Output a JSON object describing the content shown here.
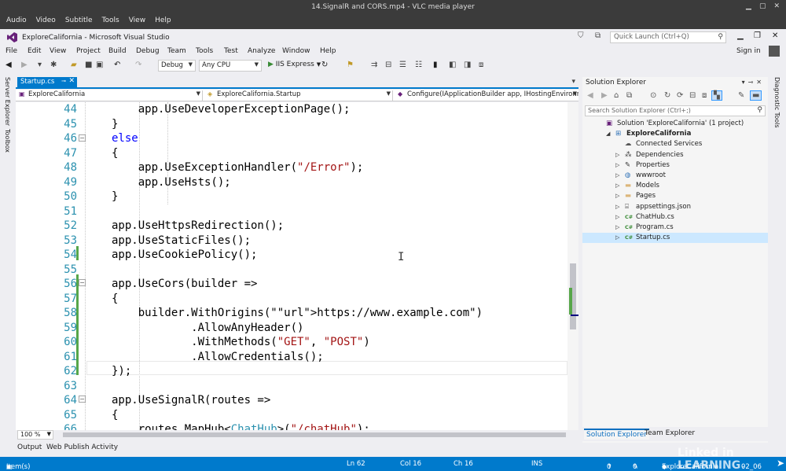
{
  "vlc": {
    "title": "14.SignalR and CORS.mp4 - VLC media player",
    "menu": [
      "Audio",
      "Video",
      "Subtitle",
      "Tools",
      "View",
      "Help"
    ]
  },
  "vs": {
    "title": "ExploreCalifornia - Microsoft Visual Studio",
    "quick_launch_placeholder": "Quick Launch (Ctrl+Q)",
    "menu": [
      "File",
      "Edit",
      "View",
      "Project",
      "Build",
      "Debug",
      "Team",
      "Tools",
      "Test",
      "Analyze",
      "Window",
      "Help"
    ],
    "sign_in": "Sign in"
  },
  "toolbar": {
    "config": "Debug",
    "platform": "Any CPU",
    "run_target": "IIS Express"
  },
  "side_left": {
    "server_explorer": "Server Explorer",
    "toolbox": "Toolbox"
  },
  "side_right": {
    "diagnostic_tools": "Diagnostic Tools"
  },
  "doc_tab": {
    "label": "Startup.cs"
  },
  "nav": {
    "project": "ExploreCalifornia",
    "class": "ExploreCalifornia.Startup",
    "member": "Configure(IApplicationBuilder app, IHostingEnvironme"
  },
  "editor": {
    "lines": [
      {
        "n": "44",
        "t": "            app.UseDeveloperExceptionPage();"
      },
      {
        "n": "45",
        "t": "        }"
      },
      {
        "n": "46",
        "t": "        else"
      },
      {
        "n": "47",
        "t": "        {"
      },
      {
        "n": "48",
        "t": "            app.UseExceptionHandler(\"/Error\");"
      },
      {
        "n": "49",
        "t": "            app.UseHsts();"
      },
      {
        "n": "50",
        "t": "        }"
      },
      {
        "n": "51",
        "t": ""
      },
      {
        "n": "52",
        "t": "        app.UseHttpsRedirection();"
      },
      {
        "n": "53",
        "t": "        app.UseStaticFiles();"
      },
      {
        "n": "54",
        "t": "        app.UseCookiePolicy();"
      },
      {
        "n": "55",
        "t": ""
      },
      {
        "n": "56",
        "t": "        app.UseCors(builder =>"
      },
      {
        "n": "57",
        "t": "        {"
      },
      {
        "n": "58",
        "t": "            builder.WithOrigins(\"https://www.example.com\")"
      },
      {
        "n": "59",
        "t": "                    .AllowAnyHeader()"
      },
      {
        "n": "60",
        "t": "                    .WithMethods(\"GET\", \"POST\")"
      },
      {
        "n": "61",
        "t": "                    .AllowCredentials();"
      },
      {
        "n": "62",
        "t": "        });"
      },
      {
        "n": "63",
        "t": ""
      },
      {
        "n": "64",
        "t": "        app.UseSignalR(routes =>"
      },
      {
        "n": "65",
        "t": "        {"
      },
      {
        "n": "66",
        "t": "            routes.MapHub<ChatHub>(\"/chatHub\");"
      }
    ]
  },
  "zoom": "100 %",
  "bottom_tabs": [
    "Output",
    "Web Publish Activity"
  ],
  "solution_explorer": {
    "title": "Solution Explorer",
    "search_placeholder": "Search Solution Explorer (Ctrl+;)",
    "tree": [
      {
        "label": "Solution 'ExploreCalifornia' (1 project)",
        "level": 0,
        "exp": "",
        "icon": "solution-icon"
      },
      {
        "label": "ExploreCalifornia",
        "level": 1,
        "exp": "open",
        "icon": "project-icon",
        "bold": true
      },
      {
        "label": "Connected Services",
        "level": 2,
        "exp": "",
        "icon": "connected-services-icon"
      },
      {
        "label": "Dependencies",
        "level": 2,
        "exp": "closed",
        "icon": "dependencies-icon"
      },
      {
        "label": "Properties",
        "level": 2,
        "exp": "closed",
        "icon": "properties-icon"
      },
      {
        "label": "wwwroot",
        "level": 2,
        "exp": "closed",
        "icon": "globe-icon"
      },
      {
        "label": "Models",
        "level": 2,
        "exp": "closed",
        "icon": "folder-icon"
      },
      {
        "label": "Pages",
        "level": 2,
        "exp": "closed",
        "icon": "folder-icon"
      },
      {
        "label": "appsettings.json",
        "level": 2,
        "exp": "closed",
        "icon": "json-file-icon"
      },
      {
        "label": "ChatHub.cs",
        "level": 2,
        "exp": "closed",
        "icon": "csharp-file-icon"
      },
      {
        "label": "Program.cs",
        "level": 2,
        "exp": "closed",
        "icon": "csharp-file-icon"
      },
      {
        "label": "Startup.cs",
        "level": 2,
        "exp": "closed",
        "icon": "csharp-file-icon",
        "selected": true
      }
    ],
    "tabs": [
      "Solution Explorer",
      "Team Explorer"
    ]
  },
  "status": {
    "message": "Item(s) Saved",
    "ln": "Ln 62",
    "col": "Col 16",
    "ch": "Ch 16",
    "mode": "INS",
    "up": "0",
    "edits": "0",
    "repo": "ExploreCalifornia",
    "branch": "02_06"
  },
  "watermark": "Linked in LEARNING"
}
